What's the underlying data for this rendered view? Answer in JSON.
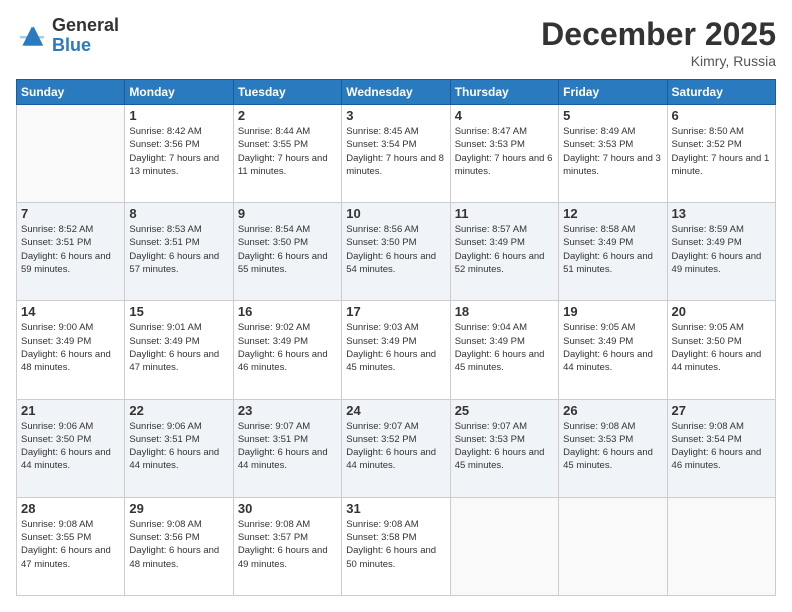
{
  "header": {
    "logo_general": "General",
    "logo_blue": "Blue",
    "month_title": "December 2025",
    "location": "Kimry, Russia"
  },
  "days_of_week": [
    "Sunday",
    "Monday",
    "Tuesday",
    "Wednesday",
    "Thursday",
    "Friday",
    "Saturday"
  ],
  "weeks": [
    [
      {
        "day": "",
        "sunrise": "",
        "sunset": "",
        "daylight": ""
      },
      {
        "day": "1",
        "sunrise": "Sunrise: 8:42 AM",
        "sunset": "Sunset: 3:56 PM",
        "daylight": "Daylight: 7 hours and 13 minutes."
      },
      {
        "day": "2",
        "sunrise": "Sunrise: 8:44 AM",
        "sunset": "Sunset: 3:55 PM",
        "daylight": "Daylight: 7 hours and 11 minutes."
      },
      {
        "day": "3",
        "sunrise": "Sunrise: 8:45 AM",
        "sunset": "Sunset: 3:54 PM",
        "daylight": "Daylight: 7 hours and 8 minutes."
      },
      {
        "day": "4",
        "sunrise": "Sunrise: 8:47 AM",
        "sunset": "Sunset: 3:53 PM",
        "daylight": "Daylight: 7 hours and 6 minutes."
      },
      {
        "day": "5",
        "sunrise": "Sunrise: 8:49 AM",
        "sunset": "Sunset: 3:53 PM",
        "daylight": "Daylight: 7 hours and 3 minutes."
      },
      {
        "day": "6",
        "sunrise": "Sunrise: 8:50 AM",
        "sunset": "Sunset: 3:52 PM",
        "daylight": "Daylight: 7 hours and 1 minute."
      }
    ],
    [
      {
        "day": "7",
        "sunrise": "Sunrise: 8:52 AM",
        "sunset": "Sunset: 3:51 PM",
        "daylight": "Daylight: 6 hours and 59 minutes."
      },
      {
        "day": "8",
        "sunrise": "Sunrise: 8:53 AM",
        "sunset": "Sunset: 3:51 PM",
        "daylight": "Daylight: 6 hours and 57 minutes."
      },
      {
        "day": "9",
        "sunrise": "Sunrise: 8:54 AM",
        "sunset": "Sunset: 3:50 PM",
        "daylight": "Daylight: 6 hours and 55 minutes."
      },
      {
        "day": "10",
        "sunrise": "Sunrise: 8:56 AM",
        "sunset": "Sunset: 3:50 PM",
        "daylight": "Daylight: 6 hours and 54 minutes."
      },
      {
        "day": "11",
        "sunrise": "Sunrise: 8:57 AM",
        "sunset": "Sunset: 3:49 PM",
        "daylight": "Daylight: 6 hours and 52 minutes."
      },
      {
        "day": "12",
        "sunrise": "Sunrise: 8:58 AM",
        "sunset": "Sunset: 3:49 PM",
        "daylight": "Daylight: 6 hours and 51 minutes."
      },
      {
        "day": "13",
        "sunrise": "Sunrise: 8:59 AM",
        "sunset": "Sunset: 3:49 PM",
        "daylight": "Daylight: 6 hours and 49 minutes."
      }
    ],
    [
      {
        "day": "14",
        "sunrise": "Sunrise: 9:00 AM",
        "sunset": "Sunset: 3:49 PM",
        "daylight": "Daylight: 6 hours and 48 minutes."
      },
      {
        "day": "15",
        "sunrise": "Sunrise: 9:01 AM",
        "sunset": "Sunset: 3:49 PM",
        "daylight": "Daylight: 6 hours and 47 minutes."
      },
      {
        "day": "16",
        "sunrise": "Sunrise: 9:02 AM",
        "sunset": "Sunset: 3:49 PM",
        "daylight": "Daylight: 6 hours and 46 minutes."
      },
      {
        "day": "17",
        "sunrise": "Sunrise: 9:03 AM",
        "sunset": "Sunset: 3:49 PM",
        "daylight": "Daylight: 6 hours and 45 minutes."
      },
      {
        "day": "18",
        "sunrise": "Sunrise: 9:04 AM",
        "sunset": "Sunset: 3:49 PM",
        "daylight": "Daylight: 6 hours and 45 minutes."
      },
      {
        "day": "19",
        "sunrise": "Sunrise: 9:05 AM",
        "sunset": "Sunset: 3:49 PM",
        "daylight": "Daylight: 6 hours and 44 minutes."
      },
      {
        "day": "20",
        "sunrise": "Sunrise: 9:05 AM",
        "sunset": "Sunset: 3:50 PM",
        "daylight": "Daylight: 6 hours and 44 minutes."
      }
    ],
    [
      {
        "day": "21",
        "sunrise": "Sunrise: 9:06 AM",
        "sunset": "Sunset: 3:50 PM",
        "daylight": "Daylight: 6 hours and 44 minutes."
      },
      {
        "day": "22",
        "sunrise": "Sunrise: 9:06 AM",
        "sunset": "Sunset: 3:51 PM",
        "daylight": "Daylight: 6 hours and 44 minutes."
      },
      {
        "day": "23",
        "sunrise": "Sunrise: 9:07 AM",
        "sunset": "Sunset: 3:51 PM",
        "daylight": "Daylight: 6 hours and 44 minutes."
      },
      {
        "day": "24",
        "sunrise": "Sunrise: 9:07 AM",
        "sunset": "Sunset: 3:52 PM",
        "daylight": "Daylight: 6 hours and 44 minutes."
      },
      {
        "day": "25",
        "sunrise": "Sunrise: 9:07 AM",
        "sunset": "Sunset: 3:53 PM",
        "daylight": "Daylight: 6 hours and 45 minutes."
      },
      {
        "day": "26",
        "sunrise": "Sunrise: 9:08 AM",
        "sunset": "Sunset: 3:53 PM",
        "daylight": "Daylight: 6 hours and 45 minutes."
      },
      {
        "day": "27",
        "sunrise": "Sunrise: 9:08 AM",
        "sunset": "Sunset: 3:54 PM",
        "daylight": "Daylight: 6 hours and 46 minutes."
      }
    ],
    [
      {
        "day": "28",
        "sunrise": "Sunrise: 9:08 AM",
        "sunset": "Sunset: 3:55 PM",
        "daylight": "Daylight: 6 hours and 47 minutes."
      },
      {
        "day": "29",
        "sunrise": "Sunrise: 9:08 AM",
        "sunset": "Sunset: 3:56 PM",
        "daylight": "Daylight: 6 hours and 48 minutes."
      },
      {
        "day": "30",
        "sunrise": "Sunrise: 9:08 AM",
        "sunset": "Sunset: 3:57 PM",
        "daylight": "Daylight: 6 hours and 49 minutes."
      },
      {
        "day": "31",
        "sunrise": "Sunrise: 9:08 AM",
        "sunset": "Sunset: 3:58 PM",
        "daylight": "Daylight: 6 hours and 50 minutes."
      },
      {
        "day": "",
        "sunrise": "",
        "sunset": "",
        "daylight": ""
      },
      {
        "day": "",
        "sunrise": "",
        "sunset": "",
        "daylight": ""
      },
      {
        "day": "",
        "sunrise": "",
        "sunset": "",
        "daylight": ""
      }
    ]
  ]
}
